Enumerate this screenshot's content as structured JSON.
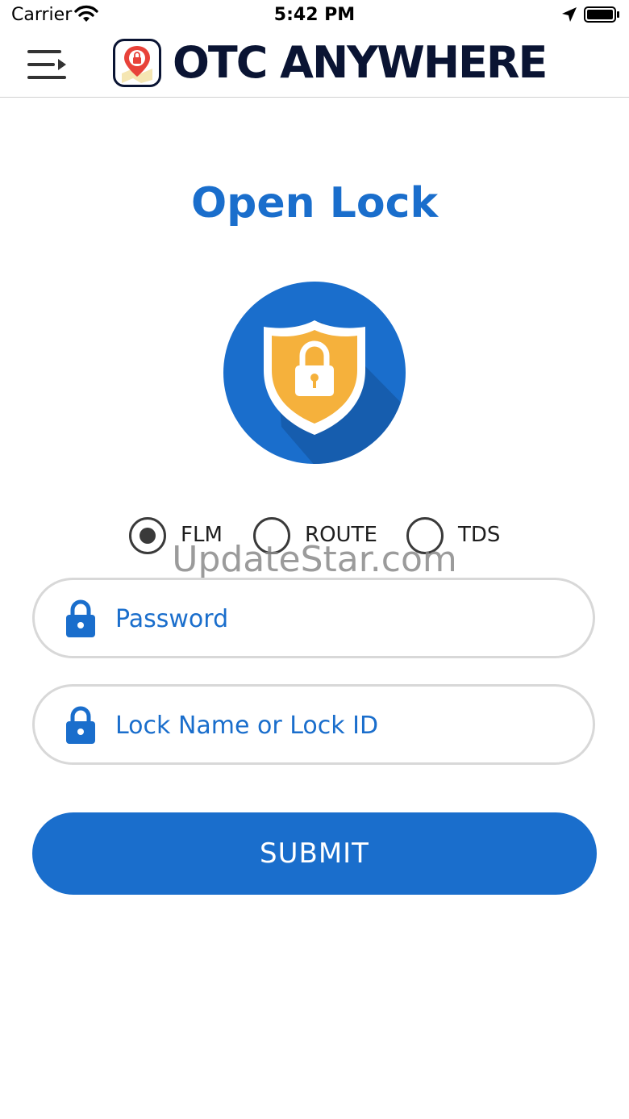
{
  "status_bar": {
    "carrier": "Carrier",
    "time": "5:42 PM"
  },
  "header": {
    "app_title": "OTC ANYWHERE"
  },
  "main": {
    "title": "Open Lock",
    "radio_options": [
      {
        "label": "FLM",
        "selected": true
      },
      {
        "label": "ROUTE",
        "selected": false
      },
      {
        "label": "TDS",
        "selected": false
      }
    ],
    "watermark": "UpdateStar.com",
    "password_field": {
      "placeholder": "Password",
      "value": ""
    },
    "lock_field": {
      "placeholder": "Lock Name or Lock ID",
      "value": ""
    },
    "submit_label": "SUBMIT"
  },
  "colors": {
    "accent": "#1a6ecc",
    "shield": "#f5b13c",
    "title_dark": "#0a1433"
  },
  "icons": {
    "menu": "hamburger-arrow-icon",
    "logo": "map-pin-lock-icon",
    "hero": "shield-lock-icon",
    "field": "padlock-icon"
  }
}
